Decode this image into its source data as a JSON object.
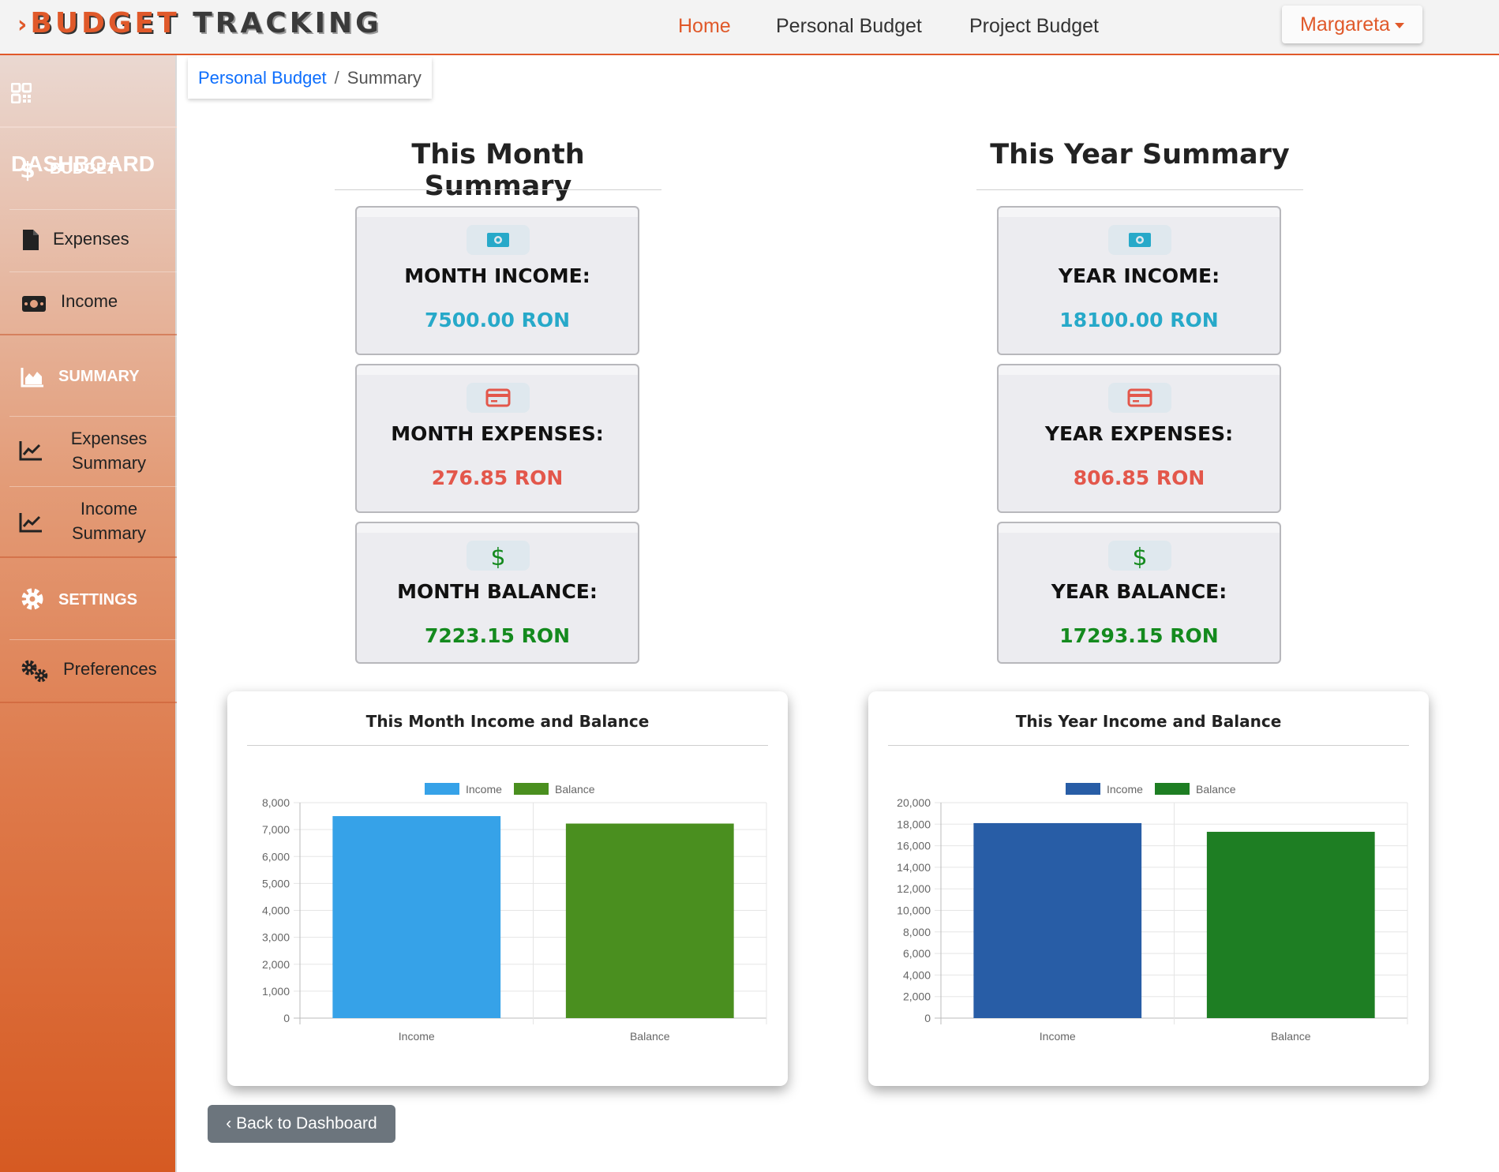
{
  "app": {
    "brand_bold": "BUDGET",
    "brand_rest": "TRACKING"
  },
  "navbar": {
    "links": [
      "Home",
      "Personal Budget",
      "Project Budget"
    ],
    "active": "Home",
    "user": "Margareta"
  },
  "sidebar": {
    "dashboard": "DASHBOARD",
    "sections": [
      {
        "label": "BUDGET",
        "icon": "dollar-icon",
        "items": [
          {
            "label": "Expenses",
            "icon": "file-icon"
          },
          {
            "label": "Income",
            "icon": "money-bill-icon"
          }
        ]
      },
      {
        "label": "SUMMARY",
        "icon": "area-chart-icon",
        "items": [
          {
            "label": "Expenses Summary",
            "icon": "line-chart-icon"
          },
          {
            "label": "Income Summary",
            "icon": "line-chart-icon"
          }
        ]
      },
      {
        "label": "SETTINGS",
        "icon": "gear-icon",
        "items": [
          {
            "label": "Preferences",
            "icon": "gears-icon"
          }
        ]
      }
    ]
  },
  "breadcrumb": {
    "parent": "Personal Budget",
    "current": "Summary"
  },
  "month": {
    "title": "This Month Summary",
    "income_label": "MONTH INCOME:",
    "income_value": "7500.00 RON",
    "expenses_label": "MONTH EXPENSES:",
    "expenses_value": "276.85 RON",
    "balance_label": "MONTH BALANCE:",
    "balance_value": "7223.15 RON"
  },
  "year": {
    "title": "This Year Summary",
    "income_label": "YEAR INCOME:",
    "income_value": "18100.00 RON",
    "expenses_label": "YEAR EXPENSES:",
    "expenses_value": "806.85 RON",
    "balance_label": "YEAR BALANCE:",
    "balance_value": "17293.15 RON"
  },
  "colors": {
    "accent": "#e0592a",
    "income": "#27a9c9",
    "expense": "#e3574b",
    "balance": "#148a1e"
  },
  "chart_data": [
    {
      "type": "bar",
      "title": "This Month Income and Balance",
      "categories": [
        "Income",
        "Balance"
      ],
      "series": [
        {
          "name": "Income",
          "color": "#36a2e8"
        },
        {
          "name": "Balance",
          "color": "#4a8f1f"
        }
      ],
      "values": [
        7500,
        7223.15
      ],
      "bar_colors": [
        "#36a2e8",
        "#4a8f1f"
      ],
      "yticks": [
        "0",
        "1,000",
        "2,000",
        "3,000",
        "4,000",
        "5,000",
        "6,000",
        "7,000",
        "8,000"
      ],
      "ylim": [
        0,
        8000
      ],
      "grid": true,
      "legend": "top"
    },
    {
      "type": "bar",
      "title": "This Year Income and Balance",
      "categories": [
        "Income",
        "Balance"
      ],
      "series": [
        {
          "name": "Income",
          "color": "#285da6"
        },
        {
          "name": "Balance",
          "color": "#1e7e23"
        }
      ],
      "values": [
        18100,
        17293.15
      ],
      "bar_colors": [
        "#285da6",
        "#1e7e23"
      ],
      "yticks": [
        "0",
        "2,000",
        "4,000",
        "6,000",
        "8,000",
        "10,000",
        "12,000",
        "14,000",
        "16,000",
        "18,000",
        "20,000"
      ],
      "ylim": [
        0,
        20000
      ],
      "grid": true,
      "legend": "top"
    }
  ],
  "back_button": "Back to Dashboard"
}
